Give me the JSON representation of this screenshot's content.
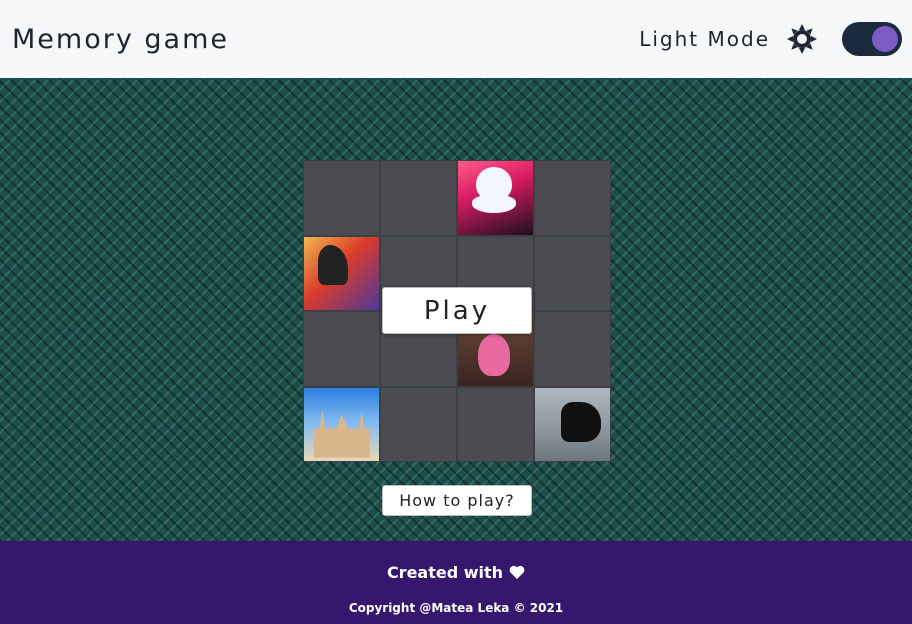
{
  "header": {
    "title": "Memory game",
    "mode_label": "Light Mode",
    "mode_icon": "sun-icon",
    "toggle_on": true,
    "colors": {
      "toggle_track": "#1c2a3e",
      "toggle_knob": "#7c5cc4"
    }
  },
  "board": {
    "rows": 4,
    "cols": 4,
    "cards": [
      {
        "state": "hidden"
      },
      {
        "state": "hidden"
      },
      {
        "state": "revealed",
        "image": "ghost-image"
      },
      {
        "state": "hidden"
      },
      {
        "state": "revealed",
        "image": "cartoon-character-image"
      },
      {
        "state": "hidden"
      },
      {
        "state": "hidden"
      },
      {
        "state": "hidden"
      },
      {
        "state": "hidden"
      },
      {
        "state": "hidden"
      },
      {
        "state": "revealed",
        "image": "doll-image"
      },
      {
        "state": "hidden"
      },
      {
        "state": "revealed",
        "image": "castle-image"
      },
      {
        "state": "hidden"
      },
      {
        "state": "hidden"
      },
      {
        "state": "revealed",
        "image": "dark-figure-image"
      }
    ]
  },
  "actions": {
    "play_label": "Play",
    "howto_label": "How to play?"
  },
  "footer": {
    "created_label": "Created with",
    "heart_icon": "heart-icon",
    "copyright": "Copyright @Matea Leka © 2021",
    "color": "#36176e"
  }
}
